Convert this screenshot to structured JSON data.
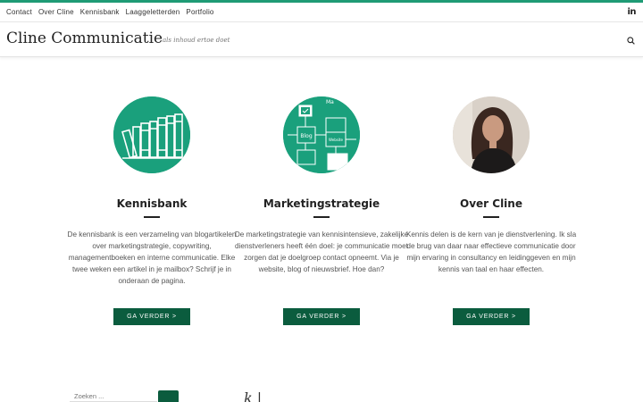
{
  "topnav": {
    "items": [
      "Contact",
      "Over Cline",
      "Kennisbank",
      "Laaggeletterden",
      "Portfolio"
    ],
    "social": "in"
  },
  "header": {
    "title": "Cline Communicatie",
    "tagline": "als inhoud ertoe doet"
  },
  "features": [
    {
      "title": "Kennisbank",
      "text": "De kennisbank is een verzameling van blogartikelen over marketingstrategie, copywriting, managementboeken en interne communicatie. Elke twee weken een artikel in je mailbox? Schrijf je in onderaan de pagina.",
      "button": "GA VERDER >"
    },
    {
      "title": "Marketingstrategie",
      "text": "De marketingstrategie van kennisintensieve, zakelijke dienstverleners heeft één doel: je communicatie moet zorgen dat je doelgroep contact opneemt. Via je website, blog of nieuwsbrief. Hoe dan?",
      "button": "GA VERDER >",
      "image_labels": {
        "blog": "Blog",
        "website": "Website",
        "top": "Ma"
      }
    },
    {
      "title": "Over Cline",
      "text": "Kennis delen is de kern van je dienstverlening. Ik sla de brug van daar naar effectieve communicatie door mijn ervaring in consultancy en leidinggeven en mijn kennis van taal en haar effecten.",
      "button": "GA VERDER >"
    }
  ],
  "footer": {
    "search_placeholder": "Zoeken ...",
    "script_text": "k   |"
  },
  "colors": {
    "accent": "#1aa07c",
    "button": "#0b5c3e",
    "top_border": "#1f9b75"
  }
}
